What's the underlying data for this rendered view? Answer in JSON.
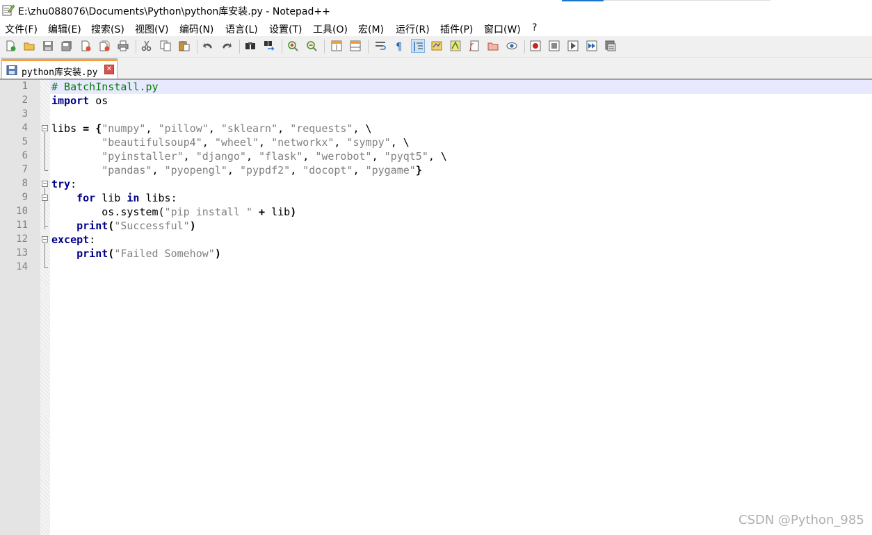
{
  "window": {
    "title": "E:\\zhu088076\\Documents\\Python\\python库安装.py - Notepad++"
  },
  "menu": {
    "items": [
      {
        "label": "文件(F)"
      },
      {
        "label": "编辑(E)"
      },
      {
        "label": "搜索(S)"
      },
      {
        "label": "视图(V)"
      },
      {
        "label": "编码(N)"
      },
      {
        "label": "语言(L)"
      },
      {
        "label": "设置(T)"
      },
      {
        "label": "工具(O)"
      },
      {
        "label": "宏(M)"
      },
      {
        "label": "运行(R)"
      },
      {
        "label": "插件(P)"
      },
      {
        "label": "窗口(W)"
      },
      {
        "label": "?"
      }
    ]
  },
  "toolbar": {
    "icons": [
      "new-file-icon",
      "open-file-icon",
      "save-icon",
      "save-all-icon",
      "close-icon",
      "close-all-icon",
      "print-icon",
      "cut-icon",
      "copy-icon",
      "paste-icon",
      "undo-icon",
      "redo-icon",
      "find-icon",
      "replace-icon",
      "zoom-in-icon",
      "zoom-out-icon",
      "sync-vertical-icon",
      "sync-horizontal-icon",
      "word-wrap-icon",
      "show-all-chars-icon",
      "indent-guide-icon",
      "udl-icon",
      "document-map-icon",
      "function-list-icon",
      "folder-workspace-icon",
      "monitoring-icon",
      "record-macro-icon",
      "stop-macro-icon",
      "play-macro-icon",
      "run-macro-multiple-icon",
      "save-macro-icon"
    ]
  },
  "tab": {
    "label": "python库安装.py"
  },
  "editor": {
    "line_numbers": [
      "1",
      "2",
      "3",
      "4",
      "5",
      "6",
      "7",
      "8",
      "9",
      "10",
      "11",
      "12",
      "13",
      "14"
    ]
  },
  "colors": {
    "keyword": "#00008b",
    "string": "#808080",
    "comment": "#008000",
    "caret_line": "#e8e8ff",
    "tab_accent": "#fa9f3a"
  },
  "watermark": "CSDN @Python_985"
}
